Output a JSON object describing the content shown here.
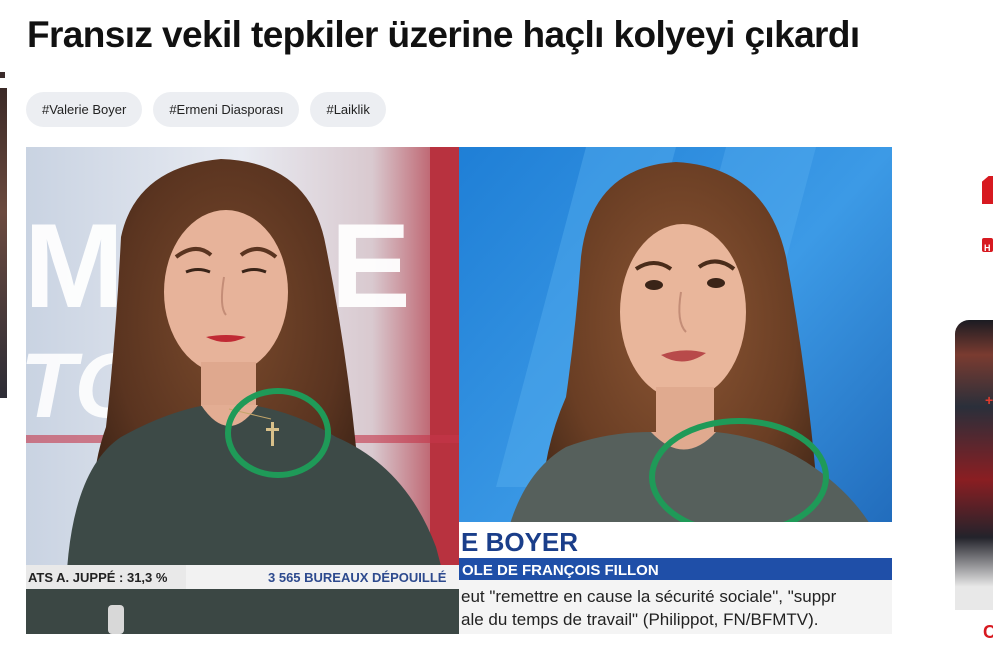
{
  "article": {
    "title": "Fransız vekil tepkiler üzerine haçlı kolyeyi çıkardı",
    "tags": [
      "#Valerie Boyer",
      "#Ermeni Diasporası",
      "#Laiklik"
    ]
  },
  "photo": {
    "left_panel": {
      "bg_text_1": "MAIRE",
      "bg_text_2": "TO",
      "ticker_text": "ATS  A. JUPPÉ : 31,3 %",
      "ticker_text_2": "3 565 BUREAUX DÉPOUILLÉ"
    },
    "right_panel": {
      "name_strip": "E BOYER",
      "role_strip": "OLE DE FRANÇOIS FILLON",
      "caption_line1": "eut \"remettre en cause la sécurité sociale\", \"suppr",
      "caption_line2": "ale du temps de travail\" (Philippot, FN/BFMTV)."
    }
  },
  "sidebar": {
    "badge": "H",
    "label": "C"
  },
  "colors": {
    "highlight_circle": "#1f9a58",
    "accent_red": "#d71920",
    "tag_bg": "#eceef2"
  }
}
